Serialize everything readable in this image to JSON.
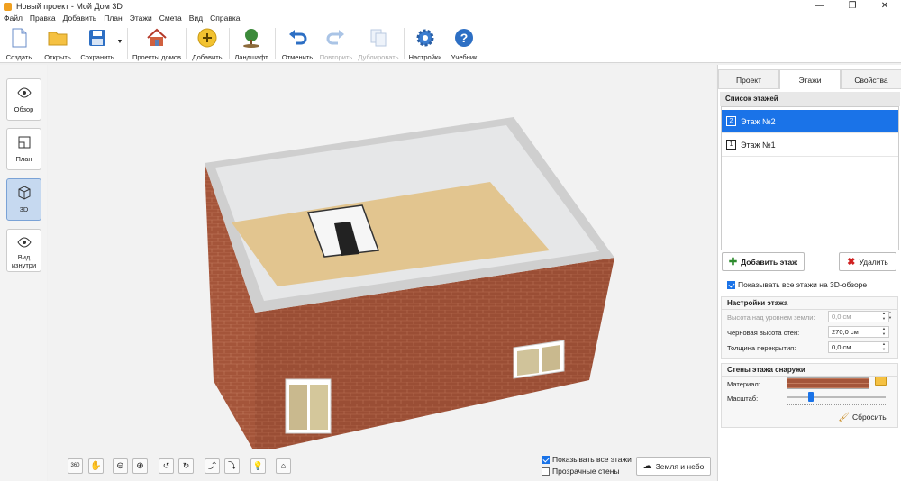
{
  "window": {
    "title": "Новый проект - Мой Дом 3D",
    "controls": [
      "—",
      "❐",
      "✕"
    ]
  },
  "menu": [
    "Файл",
    "Правка",
    "Добавить",
    "План",
    "Этажи",
    "Смета",
    "Вид",
    "Справка"
  ],
  "toolbar": {
    "create": "Создать",
    "open": "Открыть",
    "save": "Сохранить",
    "projects": "Проекты домов",
    "add": "Добавить",
    "landscape": "Ландшафт",
    "undo": "Отменить",
    "redo": "Повторить",
    "duplicate": "Дублировать",
    "settings": "Настройки",
    "tutorial": "Учебник"
  },
  "left_views": {
    "overview": "Обзор",
    "plan": "План",
    "view3d": "3D",
    "inside": "Вид изнутри"
  },
  "viewport_bottom": {
    "show_all_floors": "Показывать все этажи",
    "transparent_walls": "Прозрачные стены",
    "ground_sky": "Земля и небо",
    "rotate_label": "360"
  },
  "right_panel": {
    "tabs": [
      "Проект",
      "Этажи",
      "Свойства"
    ],
    "active_tab": "Этажи",
    "floor_list_title": "Список этажей",
    "floors": [
      {
        "label": "Этаж №2",
        "num": "2"
      },
      {
        "label": "Этаж №1",
        "num": "1"
      }
    ],
    "add_floor": "Добавить этаж",
    "delete": "Удалить",
    "show_all_3d": "Показывать все этажи на 3D-обзоре",
    "floor_settings": {
      "title": "Настройки этажа",
      "height_label": "Высота над уровнем земли:",
      "height_value": "0,0 см",
      "wall_label": "Черновая высота стен:",
      "wall_value": "270,0 см",
      "slab_label": "Толщина перекрытия:",
      "slab_value": "0,0 см"
    },
    "outer_walls": {
      "title": "Стены этажа снаружи",
      "material_label": "Материал:",
      "scale_label": "Масштаб:",
      "reset": "Сбросить"
    }
  },
  "colors": {
    "accent": "#1a73e8",
    "brick": "#a0563c",
    "floor": "#e3c590",
    "roof": "#cfcfcf"
  }
}
